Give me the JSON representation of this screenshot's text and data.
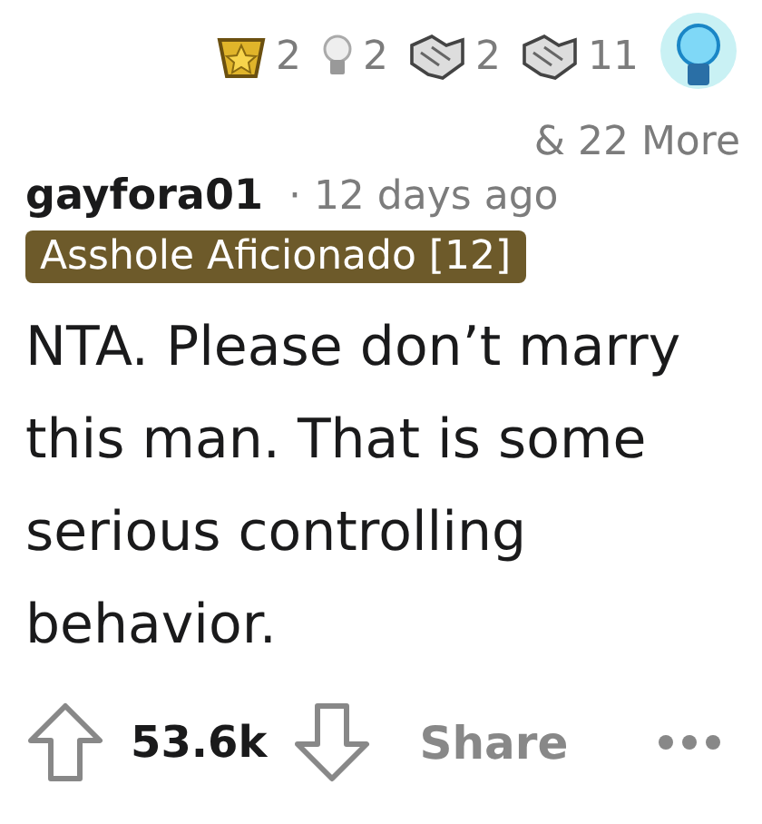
{
  "comment": {
    "author": "gayfora01",
    "flair": "Asshole Aficionado [12]",
    "time": "· 12 days ago",
    "awards": [
      {
        "kind": "star",
        "count": "2"
      },
      {
        "kind": "bulb",
        "count": "2"
      },
      {
        "kind": "hands",
        "count": "2"
      },
      {
        "kind": "hands",
        "count": "11"
      },
      {
        "kind": "glow-bulb"
      }
    ],
    "more_awards": "& 22 More",
    "body": "NTA. Please don’t marry this man. That is some serious controlling behavior.",
    "score": "53.6k",
    "share": "Share"
  }
}
